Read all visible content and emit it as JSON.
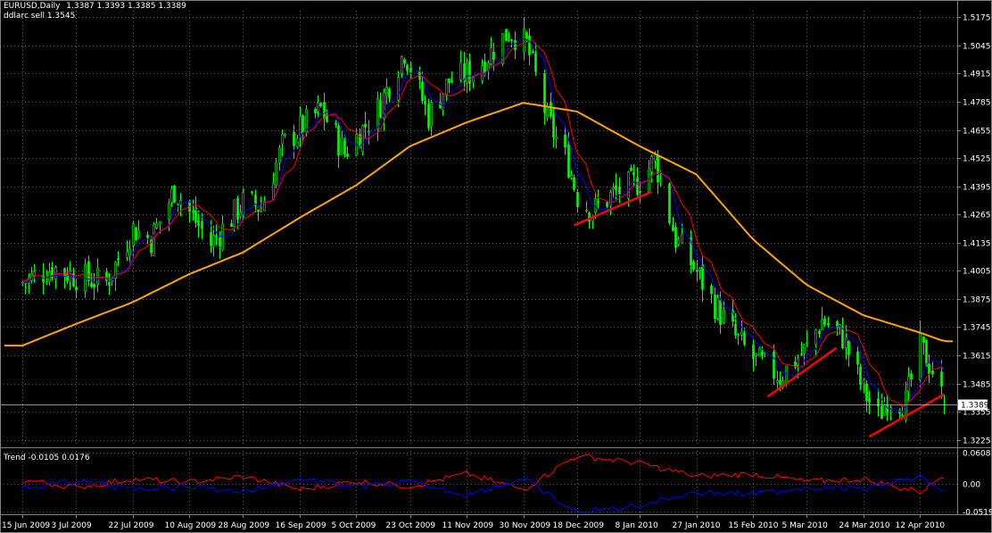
{
  "header": {
    "symbol": "EURUSD,Daily",
    "ohlc": "1.3387 1.3393 1.3385 1.3389",
    "indicator": "ddlarc sell 1.3545"
  },
  "sub_window": {
    "label": "Trend -0.0105 0.0176"
  },
  "colors": {
    "background": "#000000",
    "candles": "#00ff00",
    "fast_ma": "#ff0000",
    "slow_ma": "#0000ff",
    "long_ma": "#ffa500",
    "trendline": "#ff0000",
    "grid": "#606060",
    "current_price_line": "#c0c0c0"
  },
  "chart_data": [
    {
      "type": "candlestick",
      "symbol": "EURUSD",
      "timeframe": "Daily",
      "x_tick_labels": [
        "15 Jun 2009",
        "3 Jul 2009",
        "22 Jul 2009",
        "10 Aug 2009",
        "28 Aug 2009",
        "16 Sep 2009",
        "5 Oct 2009",
        "23 Oct 2009",
        "11 Nov 2009",
        "30 Nov 2009",
        "18 Dec 2009",
        "8 Jan 2010",
        "27 Jan 2010",
        "15 Feb 2010",
        "5 Mar 2010",
        "24 Mar 2010",
        "12 Apr 2010"
      ],
      "y_tick_labels": [
        "1.5175",
        "1.5045",
        "1.4915",
        "1.4785",
        "1.4655",
        "1.4525",
        "1.4395",
        "1.4265",
        "1.4135",
        "1.4005",
        "1.3875",
        "1.3745",
        "1.3615",
        "1.3485",
        "1.3355",
        "1.3225"
      ],
      "ylim": [
        1.3195,
        1.5205
      ],
      "current_price": "1.3389",
      "close_anchors": [
        {
          "date": "2009-06-15",
          "close": 1.395
        },
        {
          "date": "2009-06-25",
          "close": 1.402
        },
        {
          "date": "2009-07-03",
          "close": 1.398
        },
        {
          "date": "2009-07-13",
          "close": 1.395
        },
        {
          "date": "2009-07-22",
          "close": 1.42
        },
        {
          "date": "2009-07-28",
          "close": 1.415
        },
        {
          "date": "2009-08-05",
          "close": 1.438
        },
        {
          "date": "2009-08-17",
          "close": 1.413
        },
        {
          "date": "2009-08-28",
          "close": 1.432
        },
        {
          "date": "2009-09-03",
          "close": 1.43
        },
        {
          "date": "2009-09-10",
          "close": 1.458
        },
        {
          "date": "2009-09-23",
          "close": 1.475
        },
        {
          "date": "2009-10-01",
          "close": 1.455
        },
        {
          "date": "2009-10-12",
          "close": 1.475
        },
        {
          "date": "2009-10-21",
          "close": 1.502
        },
        {
          "date": "2009-10-29",
          "close": 1.472
        },
        {
          "date": "2009-11-05",
          "close": 1.488
        },
        {
          "date": "2009-11-13",
          "close": 1.492
        },
        {
          "date": "2009-11-25",
          "close": 1.511
        },
        {
          "date": "2009-12-01",
          "close": 1.505
        },
        {
          "date": "2009-12-08",
          "close": 1.47
        },
        {
          "date": "2009-12-15",
          "close": 1.45
        },
        {
          "date": "2009-12-18",
          "close": 1.435
        },
        {
          "date": "2009-12-23",
          "close": 1.428
        },
        {
          "date": "2009-12-30",
          "close": 1.436
        },
        {
          "date": "2010-01-08",
          "close": 1.442
        },
        {
          "date": "2010-01-13",
          "close": 1.452
        },
        {
          "date": "2010-01-20",
          "close": 1.415
        },
        {
          "date": "2010-01-27",
          "close": 1.4
        },
        {
          "date": "2010-02-02",
          "close": 1.385
        },
        {
          "date": "2010-02-09",
          "close": 1.37
        },
        {
          "date": "2010-02-15",
          "close": 1.36
        },
        {
          "date": "2010-02-24",
          "close": 1.352
        },
        {
          "date": "2010-03-05",
          "close": 1.365
        },
        {
          "date": "2010-03-10",
          "close": 1.378
        },
        {
          "date": "2010-03-17",
          "close": 1.37
        },
        {
          "date": "2010-03-24",
          "close": 1.345
        },
        {
          "date": "2010-03-29",
          "close": 1.333
        },
        {
          "date": "2010-04-01",
          "close": 1.342
        },
        {
          "date": "2010-04-07",
          "close": 1.34
        },
        {
          "date": "2010-04-12",
          "close": 1.365
        },
        {
          "date": "2010-04-16",
          "close": 1.355
        },
        {
          "date": "2010-04-20",
          "close": 1.3389
        }
      ],
      "long_ma_anchors": [
        {
          "date": "2009-06-15",
          "value": 1.366
        },
        {
          "date": "2009-07-03",
          "value": 1.376
        },
        {
          "date": "2009-07-22",
          "value": 1.386
        },
        {
          "date": "2009-08-10",
          "value": 1.399
        },
        {
          "date": "2009-08-28",
          "value": 1.409
        },
        {
          "date": "2009-09-16",
          "value": 1.425
        },
        {
          "date": "2009-10-05",
          "value": 1.44
        },
        {
          "date": "2009-10-23",
          "value": 1.458
        },
        {
          "date": "2009-11-11",
          "value": 1.469
        },
        {
          "date": "2009-11-30",
          "value": 1.478
        },
        {
          "date": "2009-12-18",
          "value": 1.474
        },
        {
          "date": "2010-01-08",
          "value": 1.458
        },
        {
          "date": "2010-01-27",
          "value": 1.445
        },
        {
          "date": "2010-02-15",
          "value": 1.415
        },
        {
          "date": "2010-03-05",
          "value": 1.394
        },
        {
          "date": "2010-03-24",
          "value": 1.38
        },
        {
          "date": "2010-04-12",
          "value": 1.372
        },
        {
          "date": "2010-04-20",
          "value": 1.368
        }
      ],
      "trendlines": [
        {
          "start": {
            "date": "2009-12-17",
            "price": 1.4215
          },
          "end": {
            "date": "2010-01-12",
            "price": 1.437
          }
        },
        {
          "start": {
            "date": "2010-02-20",
            "price": 1.3425
          },
          "end": {
            "date": "2010-03-15",
            "price": 1.365
          }
        },
        {
          "start": {
            "date": "2010-03-26",
            "price": 1.324
          },
          "end": {
            "date": "2010-04-20",
            "price": 1.3435
          }
        }
      ]
    },
    {
      "type": "line",
      "name": "Trend",
      "y_tick_labels": [
        "0.0608",
        "0.00",
        "-0.0519"
      ],
      "ylim": [
        -0.056,
        0.064
      ],
      "series": [
        {
          "color": "#ff0000",
          "sign": 1
        },
        {
          "color": "#0000ff",
          "sign": -1
        }
      ],
      "value_anchors": [
        {
          "date": "2009-06-15",
          "value": 0.008
        },
        {
          "date": "2009-07-03",
          "value": -0.006
        },
        {
          "date": "2009-07-22",
          "value": 0.01
        },
        {
          "date": "2009-08-10",
          "value": 0.004
        },
        {
          "date": "2009-08-28",
          "value": 0.015
        },
        {
          "date": "2009-09-16",
          "value": -0.01
        },
        {
          "date": "2009-10-05",
          "value": 0.006
        },
        {
          "date": "2009-10-23",
          "value": -0.004
        },
        {
          "date": "2009-11-11",
          "value": 0.02
        },
        {
          "date": "2009-11-30",
          "value": -0.01
        },
        {
          "date": "2009-12-18",
          "value": 0.055
        },
        {
          "date": "2010-01-08",
          "value": 0.04
        },
        {
          "date": "2010-01-27",
          "value": 0.015
        },
        {
          "date": "2010-02-15",
          "value": 0.02
        },
        {
          "date": "2010-03-05",
          "value": 0.005
        },
        {
          "date": "2010-03-24",
          "value": 0.01
        },
        {
          "date": "2010-04-12",
          "value": -0.015
        },
        {
          "date": "2010-04-20",
          "value": 0.0176
        }
      ]
    }
  ]
}
